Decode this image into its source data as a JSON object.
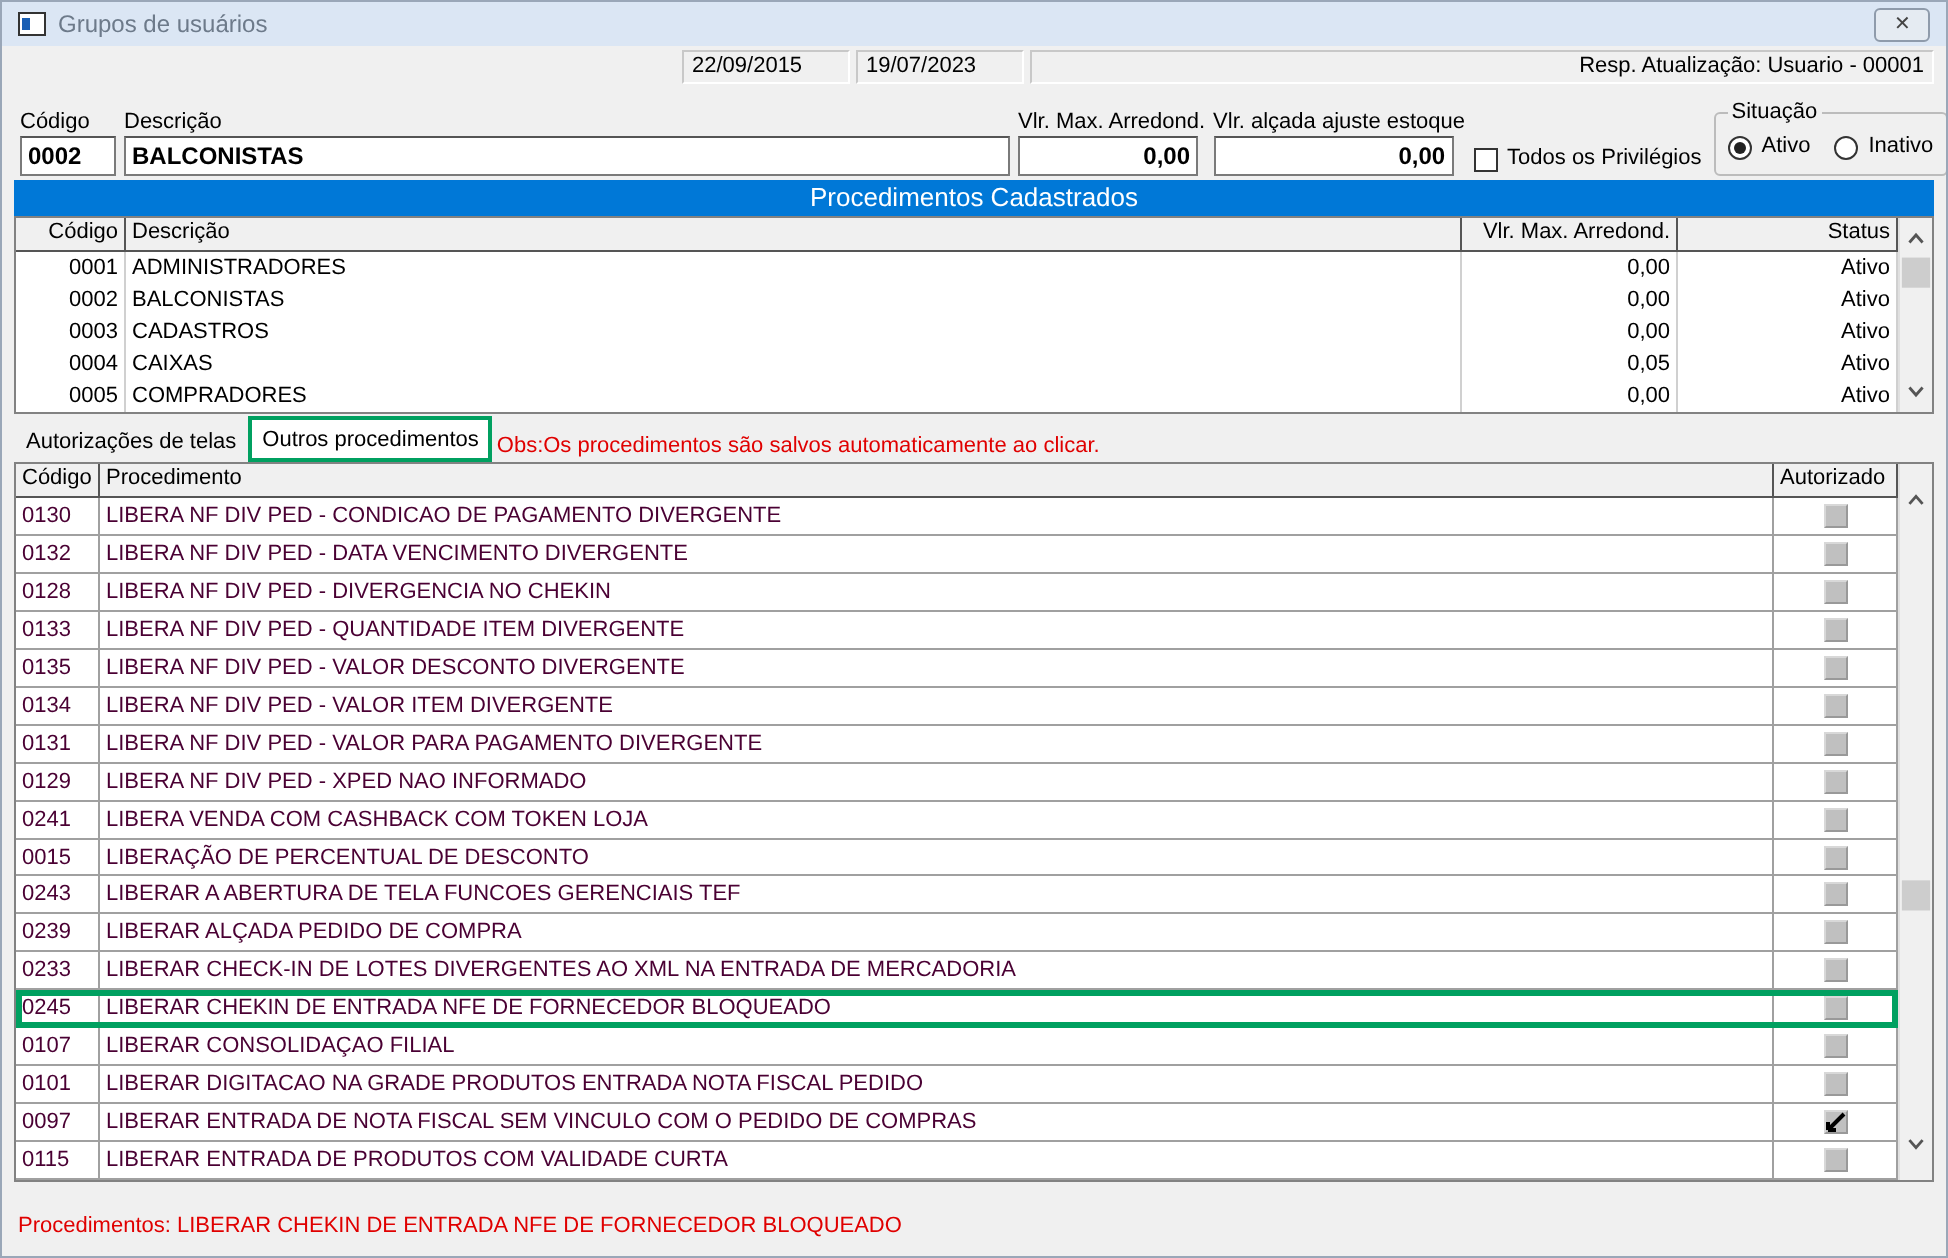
{
  "window": {
    "title": "Grupos de usuários",
    "close": "✕"
  },
  "info": {
    "dates": [
      "22/09/2015",
      "19/07/2023"
    ],
    "updated_by": "Resp. Atualização: Usuario - 00001"
  },
  "form": {
    "code": {
      "label": "Código",
      "value": "0002"
    },
    "description": {
      "label": "Descrição",
      "value": "BALCONISTAS"
    },
    "max_round": {
      "label": "Vlr. Max. Arredond.",
      "value": "0,00"
    },
    "stock_limit": {
      "label": "Vlr. alçada ajuste estoque",
      "value": "0,00"
    },
    "all_privileges": {
      "label": "Todos os Privilégios",
      "checked": false
    },
    "situation": {
      "label": "Situação",
      "options": [
        {
          "label": "Ativo",
          "selected": true
        },
        {
          "label": "Inativo",
          "selected": false
        }
      ]
    }
  },
  "groups": {
    "title": "Procedimentos Cadastrados",
    "columns": [
      "Código",
      "Descrição",
      "Vlr. Max. Arredond.",
      "Status"
    ],
    "rows": [
      [
        "0001",
        "ADMINISTRADORES",
        "0,00",
        "Ativo"
      ],
      [
        "0002",
        "BALCONISTAS",
        "0,00",
        "Ativo"
      ],
      [
        "0003",
        "CADASTROS",
        "0,00",
        "Ativo"
      ],
      [
        "0004",
        "CAIXAS",
        "0,05",
        "Ativo"
      ],
      [
        "0005",
        "COMPRADORES",
        "0,00",
        "Ativo"
      ]
    ]
  },
  "tabs": [
    {
      "label": "Autorizações de telas",
      "selected": false
    },
    {
      "label": "Outros procedimentos",
      "selected": true
    }
  ],
  "note": "Obs:Os procedimentos são salvos automaticamente ao clicar.",
  "procedures": {
    "columns": [
      "Código",
      "Procedimento",
      "Autorizado"
    ],
    "rows": [
      {
        "code": "0130",
        "name": "LIBERA NF DIV PED - CONDICAO DE PAGAMENTO DIVERGENTE",
        "authorized": false,
        "selected": false
      },
      {
        "code": "0132",
        "name": "LIBERA NF DIV PED - DATA VENCIMENTO DIVERGENTE",
        "authorized": false,
        "selected": false
      },
      {
        "code": "0128",
        "name": "LIBERA NF DIV PED - DIVERGENCIA NO CHEKIN",
        "authorized": false,
        "selected": false
      },
      {
        "code": "0133",
        "name": "LIBERA NF DIV PED - QUANTIDADE ITEM DIVERGENTE",
        "authorized": false,
        "selected": false
      },
      {
        "code": "0135",
        "name": "LIBERA NF DIV PED - VALOR DESCONTO DIVERGENTE",
        "authorized": false,
        "selected": false
      },
      {
        "code": "0134",
        "name": "LIBERA NF DIV PED - VALOR ITEM DIVERGENTE",
        "authorized": false,
        "selected": false
      },
      {
        "code": "0131",
        "name": "LIBERA NF DIV PED - VALOR PARA PAGAMENTO DIVERGENTE",
        "authorized": false,
        "selected": false
      },
      {
        "code": "0129",
        "name": "LIBERA NF DIV PED - XPED NAO INFORMADO",
        "authorized": false,
        "selected": false
      },
      {
        "code": "0241",
        "name": "LIBERA VENDA COM CASHBACK COM TOKEN LOJA",
        "authorized": false,
        "selected": false
      },
      {
        "code": "0015",
        "name": "LIBERAÇÃO DE PERCENTUAL DE DESCONTO",
        "authorized": false,
        "selected": false
      },
      {
        "code": "0243",
        "name": "LIBERAR A ABERTURA DE TELA FUNCOES GERENCIAIS TEF",
        "authorized": false,
        "selected": false
      },
      {
        "code": "0239",
        "name": "LIBERAR ALÇADA PEDIDO DE COMPRA",
        "authorized": false,
        "selected": false
      },
      {
        "code": "0233",
        "name": "LIBERAR CHECK-IN DE LOTES DIVERGENTES AO XML NA ENTRADA DE MERCADORIA",
        "authorized": false,
        "selected": false
      },
      {
        "code": "0245",
        "name": "LIBERAR CHEKIN DE ENTRADA NFE DE FORNECEDOR BLOQUEADO",
        "authorized": false,
        "selected": true
      },
      {
        "code": "0107",
        "name": "LIBERAR CONSOLIDAÇAO FILIAL",
        "authorized": false,
        "selected": false
      },
      {
        "code": "0101",
        "name": "LIBERAR DIGITACAO NA GRADE PRODUTOS ENTRADA NOTA FISCAL PEDIDO",
        "authorized": false,
        "selected": false
      },
      {
        "code": "0097",
        "name": "LIBERAR ENTRADA DE NOTA FISCAL SEM VINCULO COM O PEDIDO DE COMPRAS",
        "authorized": true,
        "selected": false
      },
      {
        "code": "0115",
        "name": "LIBERAR ENTRADA DE PRODUTOS COM VALIDADE CURTA",
        "authorized": false,
        "selected": false
      }
    ]
  },
  "status": "Procedimentos: LIBERAR CHEKIN DE ENTRADA NFE DE FORNECEDOR BLOQUEADO"
}
